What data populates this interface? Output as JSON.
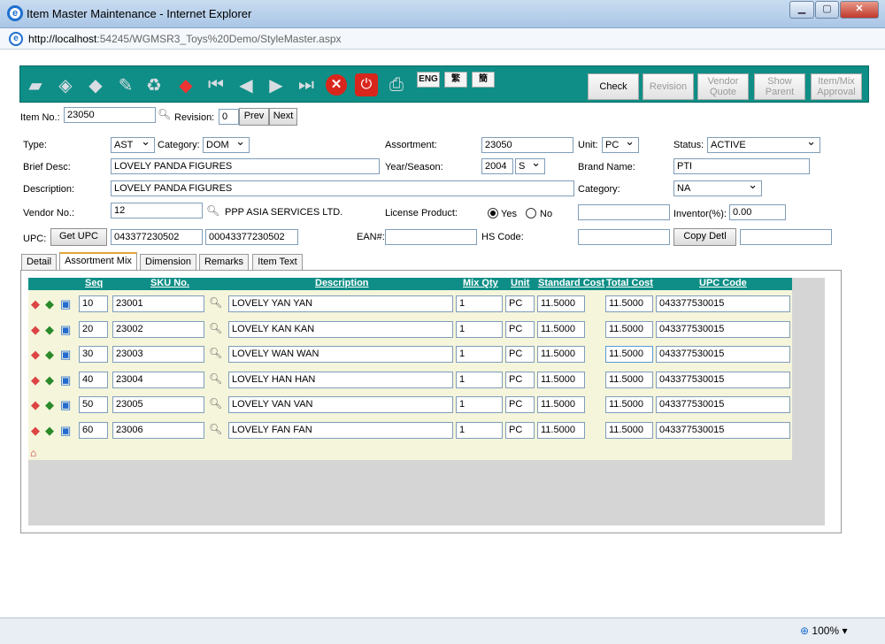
{
  "window": {
    "title": "Item Master Maintenance - Internet Explorer",
    "url_host": "http://localhost",
    "url_rest": ":54245/WGMSR3_Toys%20Demo/StyleMaster.aspx",
    "zoom": "100%"
  },
  "toolbar": {
    "lang_eng": "ENG",
    "lang_trad": "繁",
    "lang_simp": "簡",
    "check": "Check",
    "revision": "Revision",
    "vendor_quote": "Vendor Quote",
    "show_parent": "Show Parent",
    "item_mix_approval": "Item/Mix Approval"
  },
  "header": {
    "item_no_label": "Item No.:",
    "item_no": "23050",
    "revision_label": "Revision:",
    "revision": "0",
    "prev": "Prev",
    "next": "Next"
  },
  "form": {
    "type_label": "Type:",
    "type": "AST",
    "category_label": "Category:",
    "category": "DOM",
    "assortment_label": "Assortment:",
    "assortment": "23050",
    "unit_label": "Unit:",
    "unit": "PC",
    "status_label": "Status:",
    "status": "ACTIVE",
    "brief_desc_label": "Brief Desc:",
    "brief_desc": "LOVELY PANDA FIGURES",
    "year_season_label": "Year/Season:",
    "year": "2004",
    "season": "S",
    "brand_label": "Brand Name:",
    "brand": "PTI",
    "description_label": "Description:",
    "description": "LOVELY PANDA FIGURES",
    "category2_label": "Category:",
    "category2": "NA",
    "vendor_label": "Vendor No.:",
    "vendor_no": "12",
    "vendor_name": "PPP ASIA SERVICES LTD.",
    "license_label": "License Product:",
    "yes": "Yes",
    "no": "No",
    "license_value": "",
    "inventor_label": "Inventor(%):",
    "inventor": "0.00",
    "upc_label": "UPC:",
    "get_upc": "Get UPC",
    "upc1": "043377230502",
    "upc2": "00043377230502",
    "ean_label": "EAN#:",
    "ean": "",
    "hs_label": "HS Code:",
    "hs_code": "",
    "copy_detl": "Copy Detl",
    "copy_value": ""
  },
  "tabs": [
    "Detail",
    "Assortment Mix",
    "Dimension",
    "Remarks",
    "Item Text"
  ],
  "grid": {
    "headers": {
      "seq": "Seq",
      "sku": "SKU No.",
      "description": "Description",
      "mix_qty": "Mix Qty",
      "unit": "Unit",
      "std_cost": "Standard Cost",
      "total_cost": "Total Cost",
      "upc": "UPC Code"
    },
    "rows": [
      {
        "seq": "10",
        "sku": "23001",
        "desc": "LOVELY YAN YAN",
        "qty": "1",
        "unit": "PC",
        "std": "11.5000",
        "total": "11.5000",
        "upc": "043377530015"
      },
      {
        "seq": "20",
        "sku": "23002",
        "desc": "LOVELY KAN KAN",
        "qty": "1",
        "unit": "PC",
        "std": "11.5000",
        "total": "11.5000",
        "upc": "043377530015"
      },
      {
        "seq": "30",
        "sku": "23003",
        "desc": "LOVELY WAN WAN",
        "qty": "1",
        "unit": "PC",
        "std": "11.5000",
        "total": "11.5000",
        "upc": "043377530015"
      },
      {
        "seq": "40",
        "sku": "23004",
        "desc": "LOVELY HAN HAN",
        "qty": "1",
        "unit": "PC",
        "std": "11.5000",
        "total": "11.5000",
        "upc": "043377530015"
      },
      {
        "seq": "50",
        "sku": "23005",
        "desc": "LOVELY VAN VAN",
        "qty": "1",
        "unit": "PC",
        "std": "11.5000",
        "total": "11.5000",
        "upc": "043377530015"
      },
      {
        "seq": "60",
        "sku": "23006",
        "desc": "LOVELY FAN FAN",
        "qty": "1",
        "unit": "PC",
        "std": "11.5000",
        "total": "11.5000",
        "upc": "043377530015"
      }
    ]
  }
}
